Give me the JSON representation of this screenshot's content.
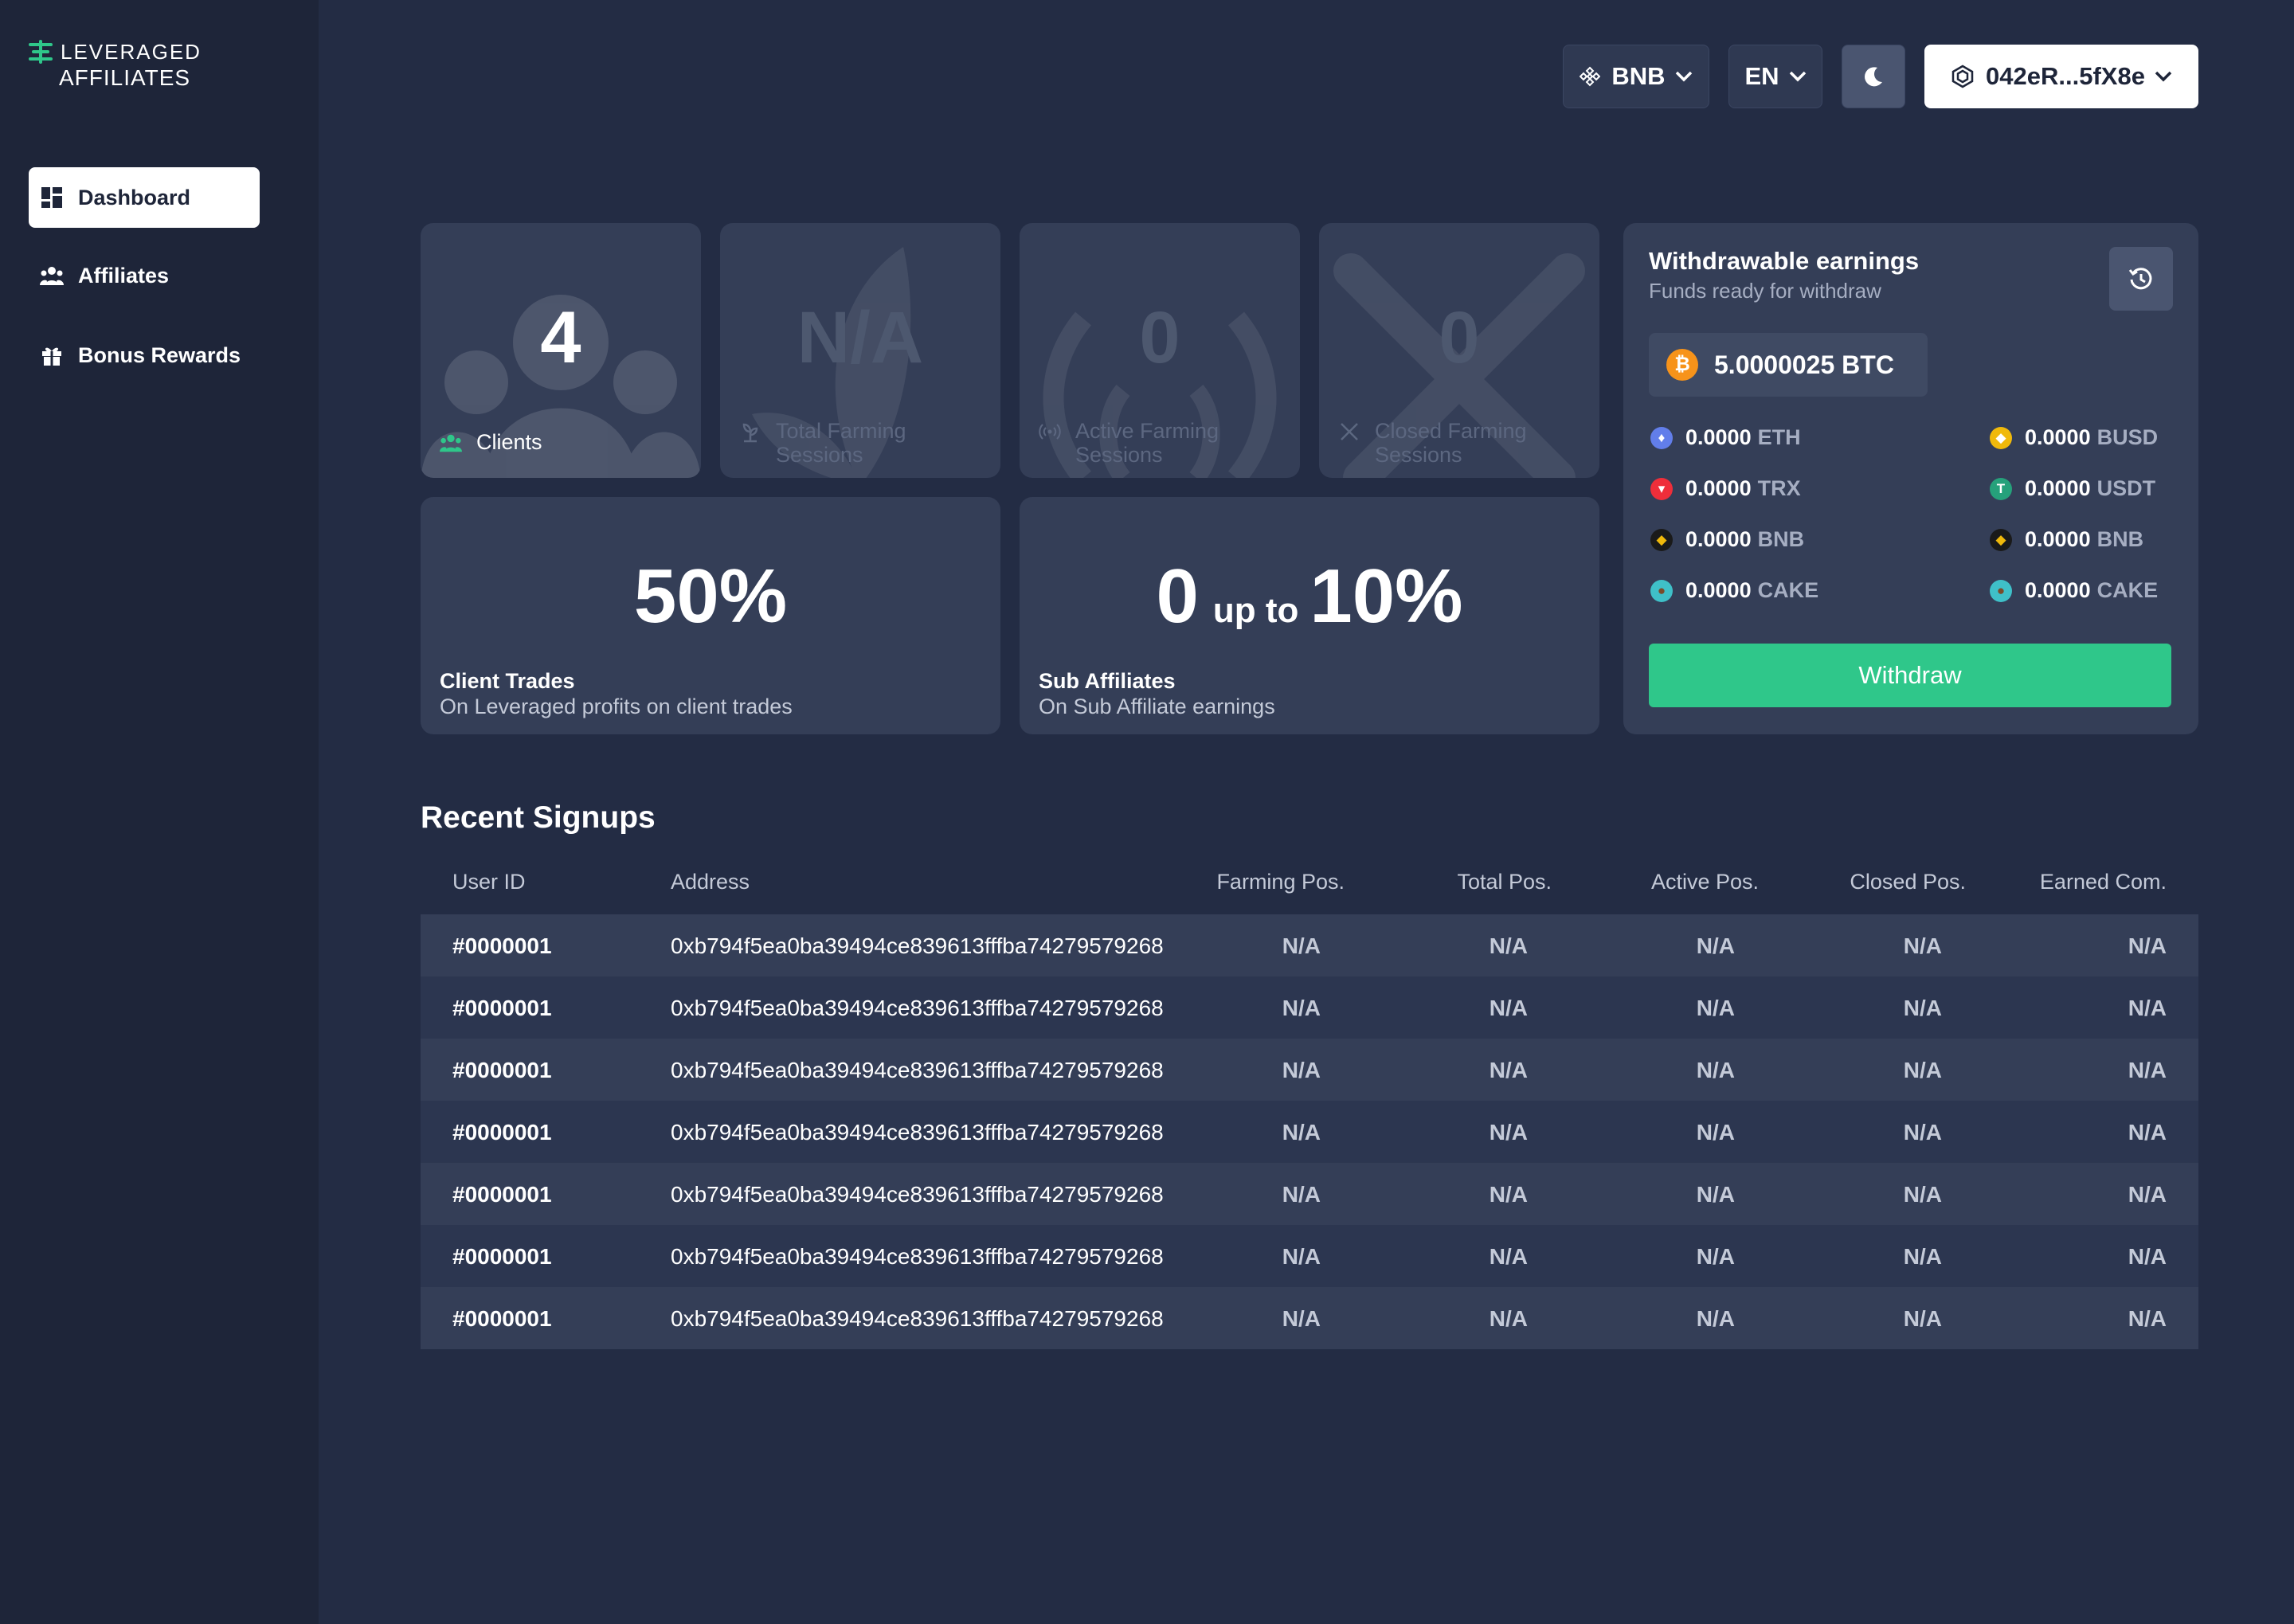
{
  "brand": {
    "line1": "LEVERAGED",
    "line2": "AFFILIATES",
    "accent": "#2fc78a"
  },
  "sidebar": {
    "items": [
      {
        "label": "Dashboard",
        "icon": "dashboard-icon",
        "active": true
      },
      {
        "label": "Affiliates",
        "icon": "users-icon",
        "active": false
      },
      {
        "label": "Bonus Rewards",
        "icon": "gift-icon",
        "active": false
      }
    ]
  },
  "topbar": {
    "network": "BNB",
    "language": "EN",
    "theme_icon": "moon-icon",
    "wallet": "042eR...5fX8e"
  },
  "stats": {
    "clients": {
      "value": "4",
      "label": "Clients"
    },
    "total_farming": {
      "value": "N/A",
      "label_line1": "Total Farming",
      "label_line2": "Sessions"
    },
    "active_farming": {
      "value": "0",
      "label_line1": "Active Farming",
      "label_line2": "Sessions"
    },
    "closed_farming": {
      "value": "0",
      "label_line1": "Closed Farming",
      "label_line2": "Sessions"
    }
  },
  "commissions": {
    "client_trades": {
      "value": "50%",
      "title": "Client Trades",
      "subtitle": "On Leveraged profits on client trades"
    },
    "sub_affiliates": {
      "min": "0",
      "joiner": "up to",
      "max": "10%",
      "title": "Sub Affiliates",
      "subtitle": "On Sub Affiliate earnings"
    }
  },
  "earnings": {
    "title": "Withdrawable earnings",
    "subtitle": "Funds ready for withdraw",
    "history_icon": "history-icon",
    "btc": "5.0000025 BTC",
    "coins_left": [
      {
        "amount": "0.0000",
        "symbol": "ETH",
        "color": "#627eea"
      },
      {
        "amount": "0.0000",
        "symbol": "TRX",
        "color": "#ef2e3a"
      },
      {
        "amount": "0.0000",
        "symbol": "BNB",
        "color": "#1a1a1a"
      },
      {
        "amount": "0.0000",
        "symbol": "CAKE",
        "color": "#3fc0c8"
      }
    ],
    "coins_right": [
      {
        "amount": "0.0000",
        "symbol": "BUSD",
        "color": "#f0b90b"
      },
      {
        "amount": "0.0000",
        "symbol": "USDT",
        "color": "#26a17b"
      },
      {
        "amount": "0.0000",
        "symbol": "BNB",
        "color": "#1a1a1a"
      },
      {
        "amount": "0.0000",
        "symbol": "CAKE",
        "color": "#3fc0c8"
      }
    ],
    "withdraw_label": "Withdraw"
  },
  "signups": {
    "title": "Recent Signups",
    "columns": [
      "User ID",
      "Address",
      "Farming Pos.",
      "Total Pos.",
      "Active Pos.",
      "Closed Pos.",
      "Earned Com."
    ],
    "rows": [
      [
        "#0000001",
        "0xb794f5ea0ba39494ce839613fffba74279579268",
        "N/A",
        "N/A",
        "N/A",
        "N/A",
        "N/A"
      ],
      [
        "#0000001",
        "0xb794f5ea0ba39494ce839613fffba74279579268",
        "N/A",
        "N/A",
        "N/A",
        "N/A",
        "N/A"
      ],
      [
        "#0000001",
        "0xb794f5ea0ba39494ce839613fffba74279579268",
        "N/A",
        "N/A",
        "N/A",
        "N/A",
        "N/A"
      ],
      [
        "#0000001",
        "0xb794f5ea0ba39494ce839613fffba74279579268",
        "N/A",
        "N/A",
        "N/A",
        "N/A",
        "N/A"
      ],
      [
        "#0000001",
        "0xb794f5ea0ba39494ce839613fffba74279579268",
        "N/A",
        "N/A",
        "N/A",
        "N/A",
        "N/A"
      ],
      [
        "#0000001",
        "0xb794f5ea0ba39494ce839613fffba74279579268",
        "N/A",
        "N/A",
        "N/A",
        "N/A",
        "N/A"
      ],
      [
        "#0000001",
        "0xb794f5ea0ba39494ce839613fffba74279579268",
        "N/A",
        "N/A",
        "N/A",
        "N/A",
        "N/A"
      ]
    ]
  }
}
